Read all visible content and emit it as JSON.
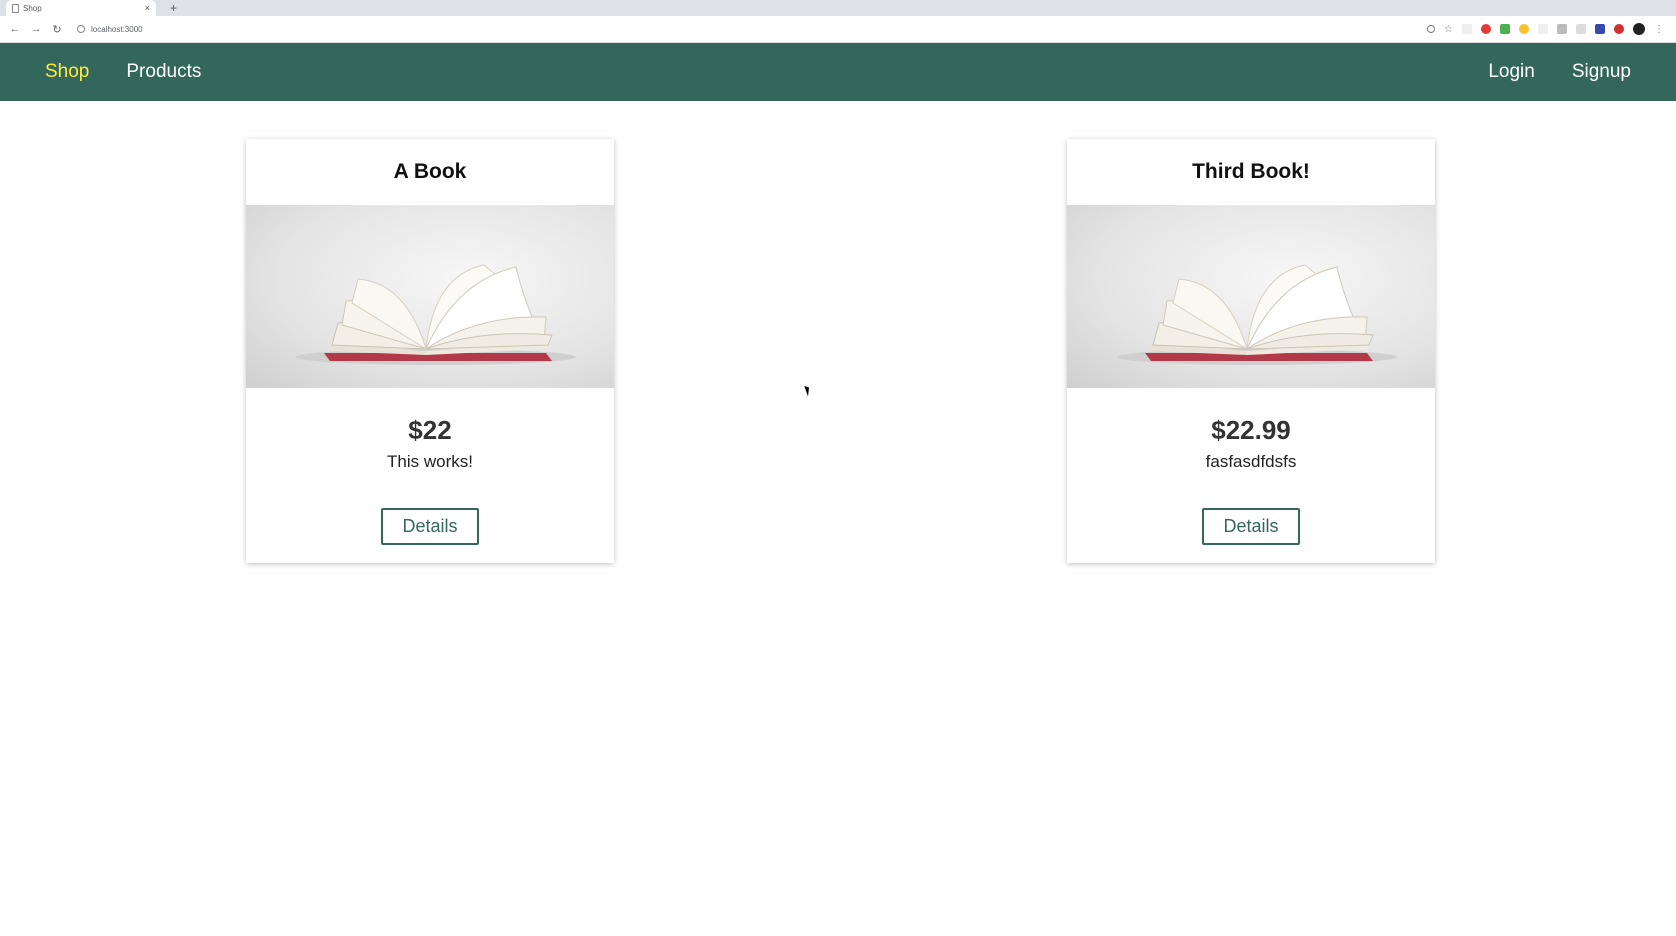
{
  "browser": {
    "tab_title": "Shop",
    "tab_close": "×",
    "new_tab": "+",
    "url": "localhost:3000",
    "back": "←",
    "forward": "→",
    "reload": "↻"
  },
  "nav": {
    "left": [
      {
        "label": "Shop",
        "active": true
      },
      {
        "label": "Products",
        "active": false
      }
    ],
    "right": [
      {
        "label": "Login"
      },
      {
        "label": "Signup"
      }
    ]
  },
  "products": [
    {
      "title": "A Book",
      "price": "$22",
      "description": "This works!",
      "button": "Details"
    },
    {
      "title": "Third Book!",
      "price": "$22.99",
      "description": "fasfasdfdsfs",
      "button": "Details"
    }
  ],
  "colors": {
    "header_bg": "#34675c",
    "active_link": "#ffeb3b",
    "button_border": "#34675c"
  }
}
